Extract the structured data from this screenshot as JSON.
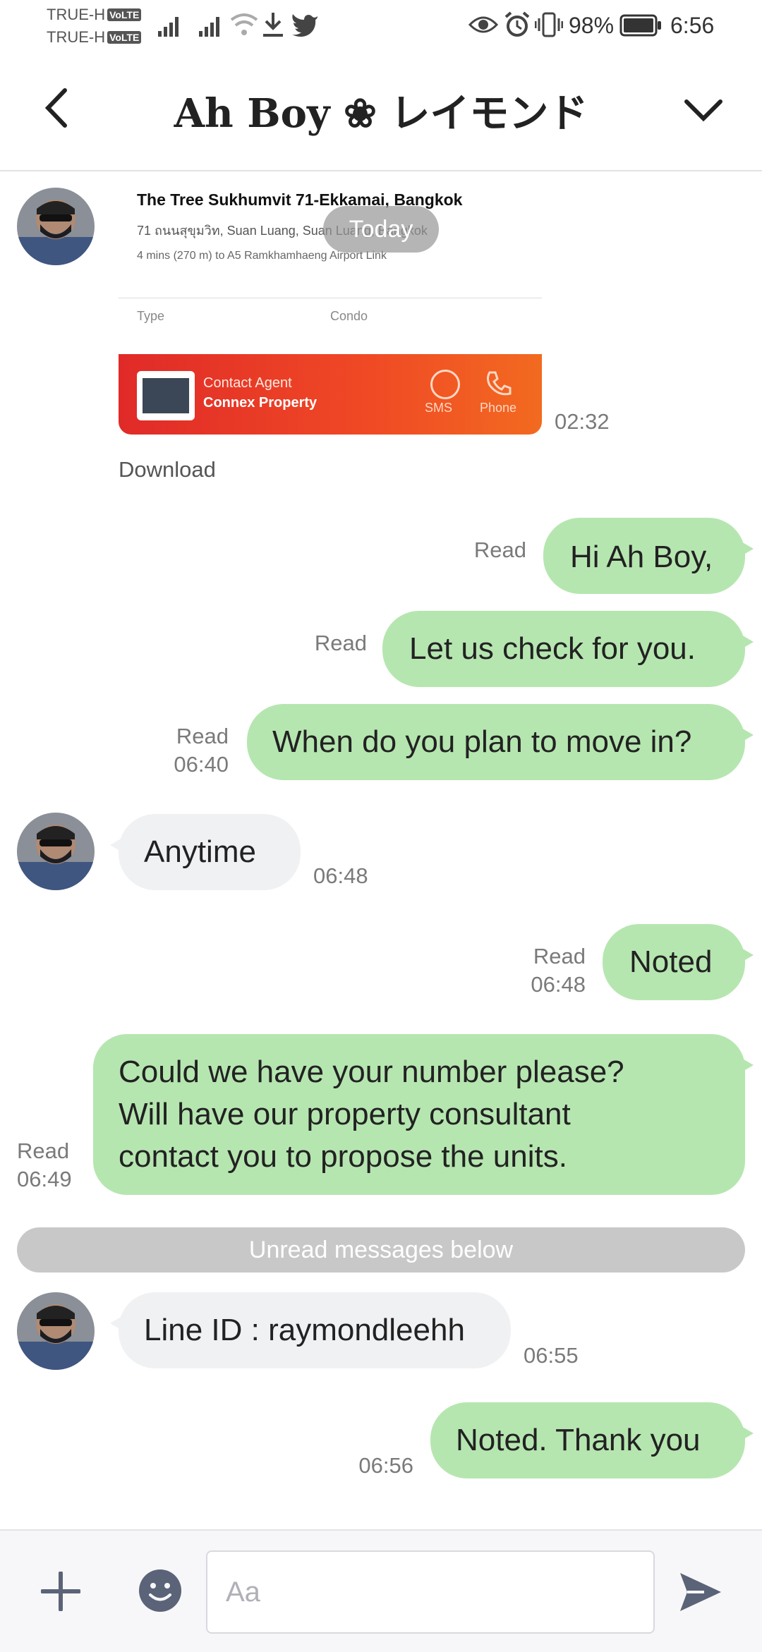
{
  "status_bar": {
    "carrier_1": "TRUE-H",
    "carrier_2": "TRUE-H",
    "volte": "VoLTE",
    "battery": "98%",
    "time": "6:56"
  },
  "header": {
    "title": "Ah Boy ❀ レイモンド"
  },
  "shared_card": {
    "line1": "The Tree Sukhumvit 71-Ekkamai, Bangkok",
    "line2": "71 ถนนสุขุมวิท, Suan Luang, Suan Luang, Bangkok",
    "line3": "4 mins (270 m) to A5 Ramkhamhaeng Airport Link",
    "col_type": "Type",
    "col_condo": "Condo",
    "agent_label": "Contact Agent",
    "agent_name": "Connex Property",
    "sms": "SMS",
    "phone": "Phone",
    "time": "02:32",
    "download": "Download"
  },
  "date_chip": "Today",
  "messages": [
    {
      "text": "Hi Ah Boy,",
      "status": "Read",
      "time": ""
    },
    {
      "text": "Let us check for you.",
      "status": "Read",
      "time": ""
    },
    {
      "text": "When do you plan to move in?",
      "status": "Read",
      "time": "06:40"
    },
    {
      "text": "Anytime",
      "time": "06:48"
    },
    {
      "text": "Noted",
      "status": "Read",
      "time": "06:48"
    },
    {
      "text_lines": [
        "Could we have your number please?",
        "Will have our property consultant",
        "contact you to propose the units."
      ],
      "status": "Read",
      "time": "06:49"
    },
    {
      "text": "Line ID : raymondleehh",
      "time": "06:55"
    },
    {
      "text": "Noted. Thank you",
      "time": "06:56"
    }
  ],
  "unread_divider": "Unread messages below",
  "composer": {
    "placeholder": "Aa"
  },
  "colors": {
    "my_bubble": "#b6e6b0",
    "their_bubble": "#f0f1f3",
    "icon": "#5b6378"
  }
}
